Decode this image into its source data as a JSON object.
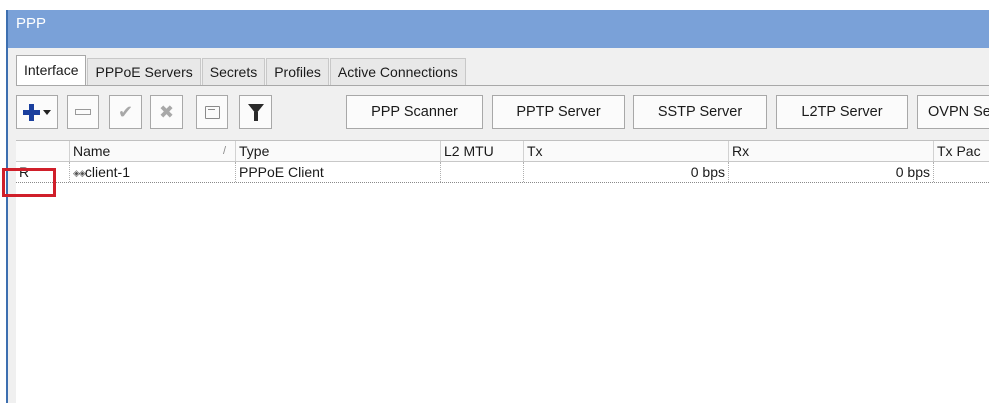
{
  "window": {
    "title": "PPP"
  },
  "tabs": [
    "Interface",
    "PPPoE Servers",
    "Secrets",
    "Profiles",
    "Active Connections"
  ],
  "toolbar": {
    "buttons": [
      "PPP Scanner",
      "PPTP Server",
      "SSTP Server",
      "L2TP Server",
      "OVPN Se"
    ],
    "icons": [
      "add-icon",
      "remove-icon",
      "enable-icon",
      "disable-icon",
      "comment-icon",
      "filter-icon"
    ]
  },
  "table": {
    "columns": [
      "Name",
      "Type",
      "L2 MTU",
      "Tx",
      "Rx",
      "Tx Pac"
    ],
    "sort_indicator": "/",
    "rows": [
      {
        "flag": "R",
        "name": "client-1",
        "type": "PPPoE Client",
        "l2mtu": "",
        "tx": "0 bps",
        "rx": "0 bps",
        "txpac": ""
      }
    ]
  },
  "colors": {
    "title_bar": "#7aa1d8",
    "highlight_box": "#d01f2a",
    "add_icon": "#1a3f9e"
  }
}
